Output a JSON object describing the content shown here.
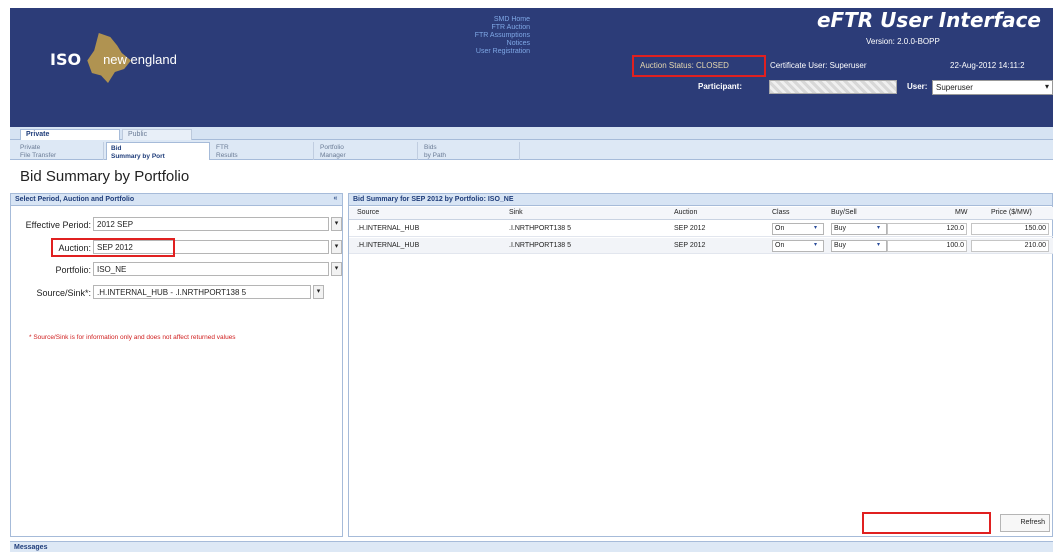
{
  "header": {
    "logo_iso": "ISO",
    "logo_ne": "new england",
    "smd_links": [
      "SMD Home",
      "FTR Auction",
      "FTR Assumptions",
      "Notices",
      "User Registration"
    ],
    "title": "eFTR User Interface",
    "version": "Version: 2.0.0-BOPP",
    "auction_status": "Auction Status: CLOSED",
    "certificate_user": "Certificate User: Superuser",
    "date": "22-Aug-2012 14:11:2",
    "participant_label": "Participant:",
    "user_label": "User:",
    "user_value": "Superuser"
  },
  "tabs": [
    {
      "label": "Private"
    },
    {
      "label": "Public"
    }
  ],
  "subtabs": [
    {
      "line1": "Private",
      "line2": "File Transfer"
    },
    {
      "line1": "Bid",
      "line2": "Summary by Port"
    },
    {
      "line1": "FTR",
      "line2": "Results"
    },
    {
      "line1": "Portfolio",
      "line2": "Manager"
    },
    {
      "line1": "Bids",
      "line2": "by Path"
    }
  ],
  "page_title": "Bid Summary by Portfolio",
  "left_panel": {
    "header": "Select Period, Auction and Portfolio",
    "collapse": "«",
    "effective_period_label": "Effective Period:",
    "effective_period_value": "2012 SEP",
    "auction_label": "Auction:",
    "auction_value": "SEP 2012",
    "portfolio_label": "Portfolio:",
    "portfolio_value": "ISO_NE",
    "source_sink_label": "Source/Sink*:",
    "source_sink_value": ".H.INTERNAL_HUB - .I.NRTHPORT138 5",
    "note": "* Source/Sink is for information only and does not affect returned values"
  },
  "right_panel": {
    "header": "Bid Summary for SEP 2012 by Portfolio: ISO_NE",
    "columns": [
      "Source",
      "Sink",
      "Auction",
      "Class",
      "Buy/Sell",
      "MW",
      "Price ($/MW)"
    ],
    "rows": [
      {
        "source": ".H.INTERNAL_HUB",
        "sink": ".I.NRTHPORT138 5",
        "auction": "SEP 2012",
        "class": "On",
        "buy_sell": "Buy",
        "mw": "120.0",
        "price": "150.00"
      },
      {
        "source": ".H.INTERNAL_HUB",
        "sink": ".I.NRTHPORT138 5",
        "auction": "SEP 2012",
        "class": "On",
        "buy_sell": "Buy",
        "mw": "100.0",
        "price": "210.00"
      }
    ]
  },
  "refresh_label": "Refresh",
  "messages_label": "Messages"
}
